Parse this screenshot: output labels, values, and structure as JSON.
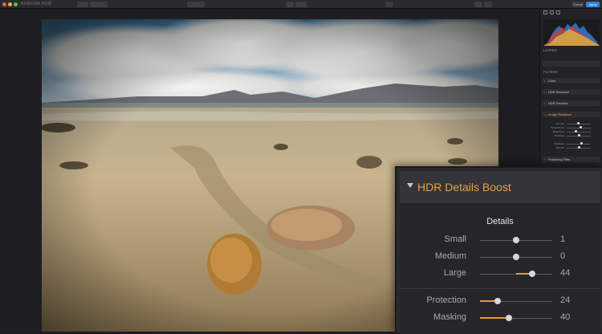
{
  "toolbar": {
    "app_title": "AURORA HDR",
    "cancel_label": "Cancel",
    "apply_label": "Apply"
  },
  "panel": {
    "layers_label": "LAYERS",
    "filters_label": "FILTERS",
    "filters": [
      {
        "label": "Color",
        "expanded": false
      },
      {
        "label": "HDR Structure",
        "expanded": false
      },
      {
        "label": "HDR Denoise",
        "expanded": false
      },
      {
        "label": "Image Radiance",
        "expanded": true
      },
      {
        "label": "Polarizing Filter",
        "expanded": false
      }
    ],
    "radiance_sliders": [
      {
        "label": "Amount",
        "value": 0.45
      },
      {
        "label": "Smoothness",
        "value": 0.55
      },
      {
        "label": "Brightness",
        "value": 0.35
      },
      {
        "label": "Shadows",
        "value": 0.5
      },
      {
        "label": "Vividness",
        "value": 0.6
      },
      {
        "label": "Warmth",
        "value": 0.5
      }
    ]
  },
  "zoom": {
    "title": "HDR Details Boost",
    "section": "Details",
    "sliders": [
      {
        "label": "Small",
        "value": "1",
        "pos": 0.5,
        "filled": false
      },
      {
        "label": "Medium",
        "value": "0",
        "pos": 0.5,
        "filled": false
      },
      {
        "label": "Large",
        "value": "44",
        "pos": 0.72,
        "filled": true
      }
    ],
    "sliders2": [
      {
        "label": "Protection",
        "value": "24",
        "pos": 0.24,
        "filled": true
      },
      {
        "label": "Masking",
        "value": "40",
        "pos": 0.4,
        "filled": true
      }
    ]
  },
  "colors": {
    "accent_orange": "#e29a3e",
    "apply_blue": "#2f7fe0"
  },
  "icons": [
    "close-icon",
    "minimize-icon",
    "zoom-icon",
    "histogram-icon",
    "chevron-right-icon",
    "triangle-down-icon"
  ]
}
